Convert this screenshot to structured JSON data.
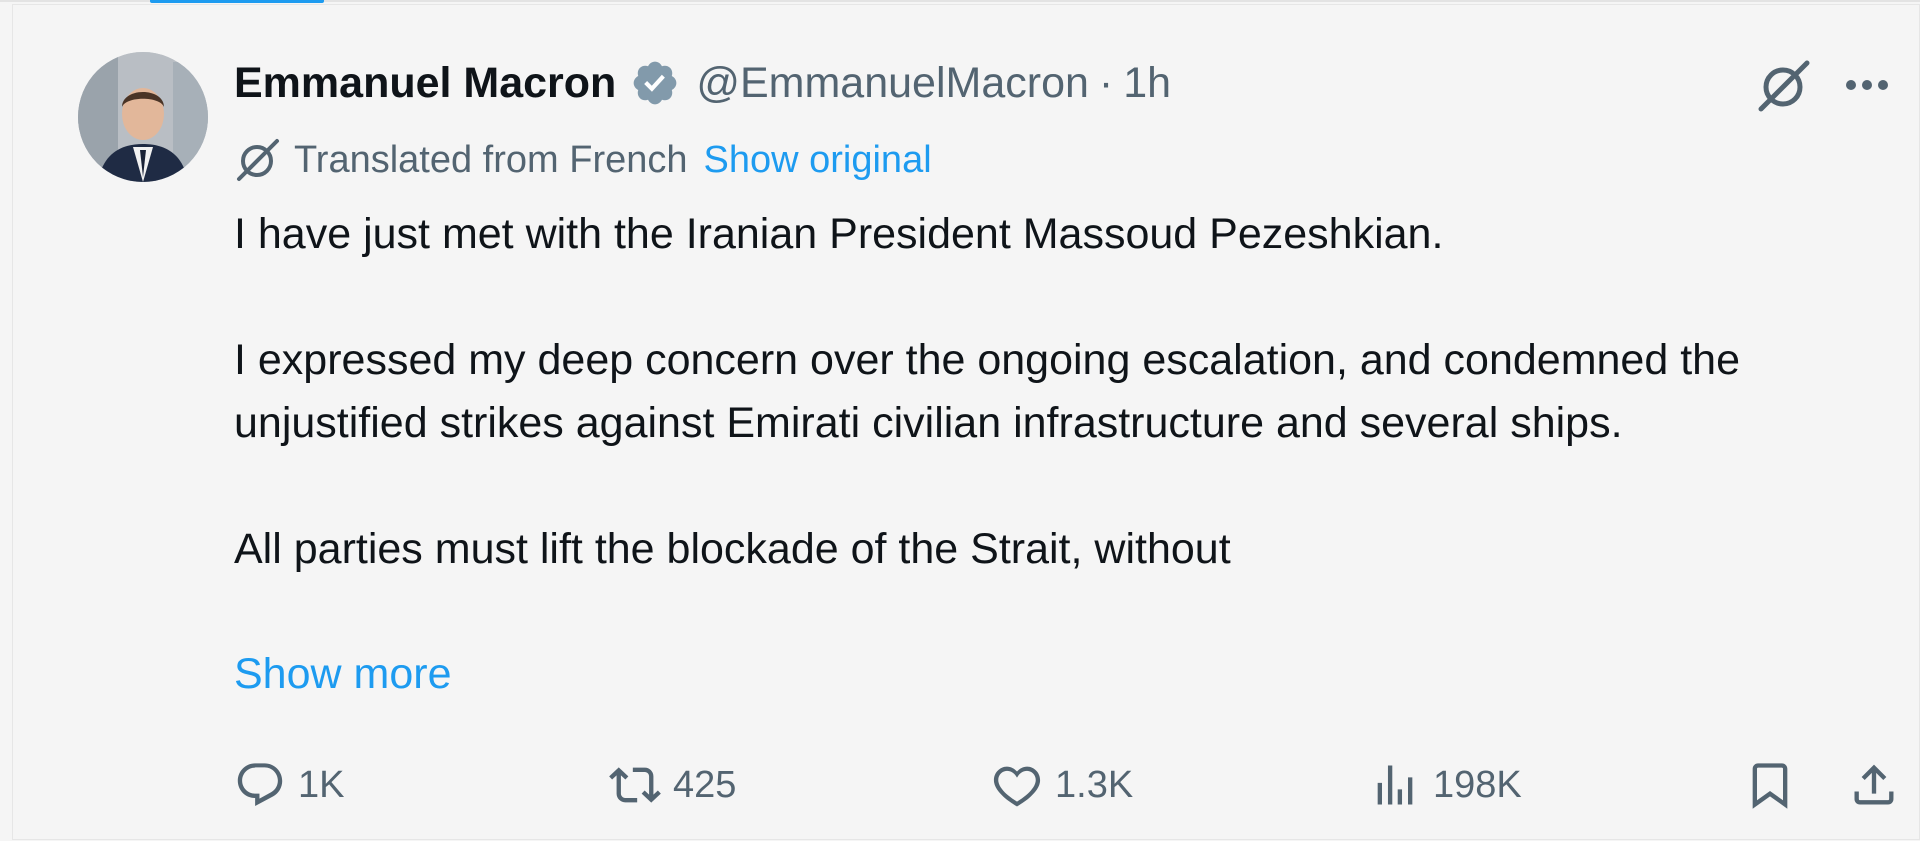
{
  "author": {
    "name": "Emmanuel Macron",
    "handle": "@EmmanuelMacron",
    "separator": "·",
    "time": "1h",
    "verified": true
  },
  "translation": {
    "label": "Translated from French",
    "link": "Show original"
  },
  "body": {
    "paragraphs": [
      "I have just met with the Iranian President Massoud Pezeshkian.",
      "I expressed my deep concern over the ongoing escalation, and condemned the unjustified strikes against Emirati civilian infrastructure and several ships.",
      "All parties must lift the blockade of the Strait, without"
    ],
    "show_more": "Show more"
  },
  "actions": {
    "replies": "1K",
    "reposts": "425",
    "likes": "1.3K",
    "views": "198K"
  },
  "colors": {
    "accent": "#1d9bf0",
    "text": "#0f1419",
    "muted": "#536471",
    "background": "#f5f5f5",
    "verified_badge": "#829aab"
  },
  "icons": {
    "verified": "verified-badge-icon",
    "grok": "grok-icon",
    "more": "more-dots-icon",
    "reply": "reply-icon",
    "repost": "repost-icon",
    "like": "heart-icon",
    "views": "views-icon",
    "bookmark": "bookmark-icon",
    "share": "share-icon"
  }
}
